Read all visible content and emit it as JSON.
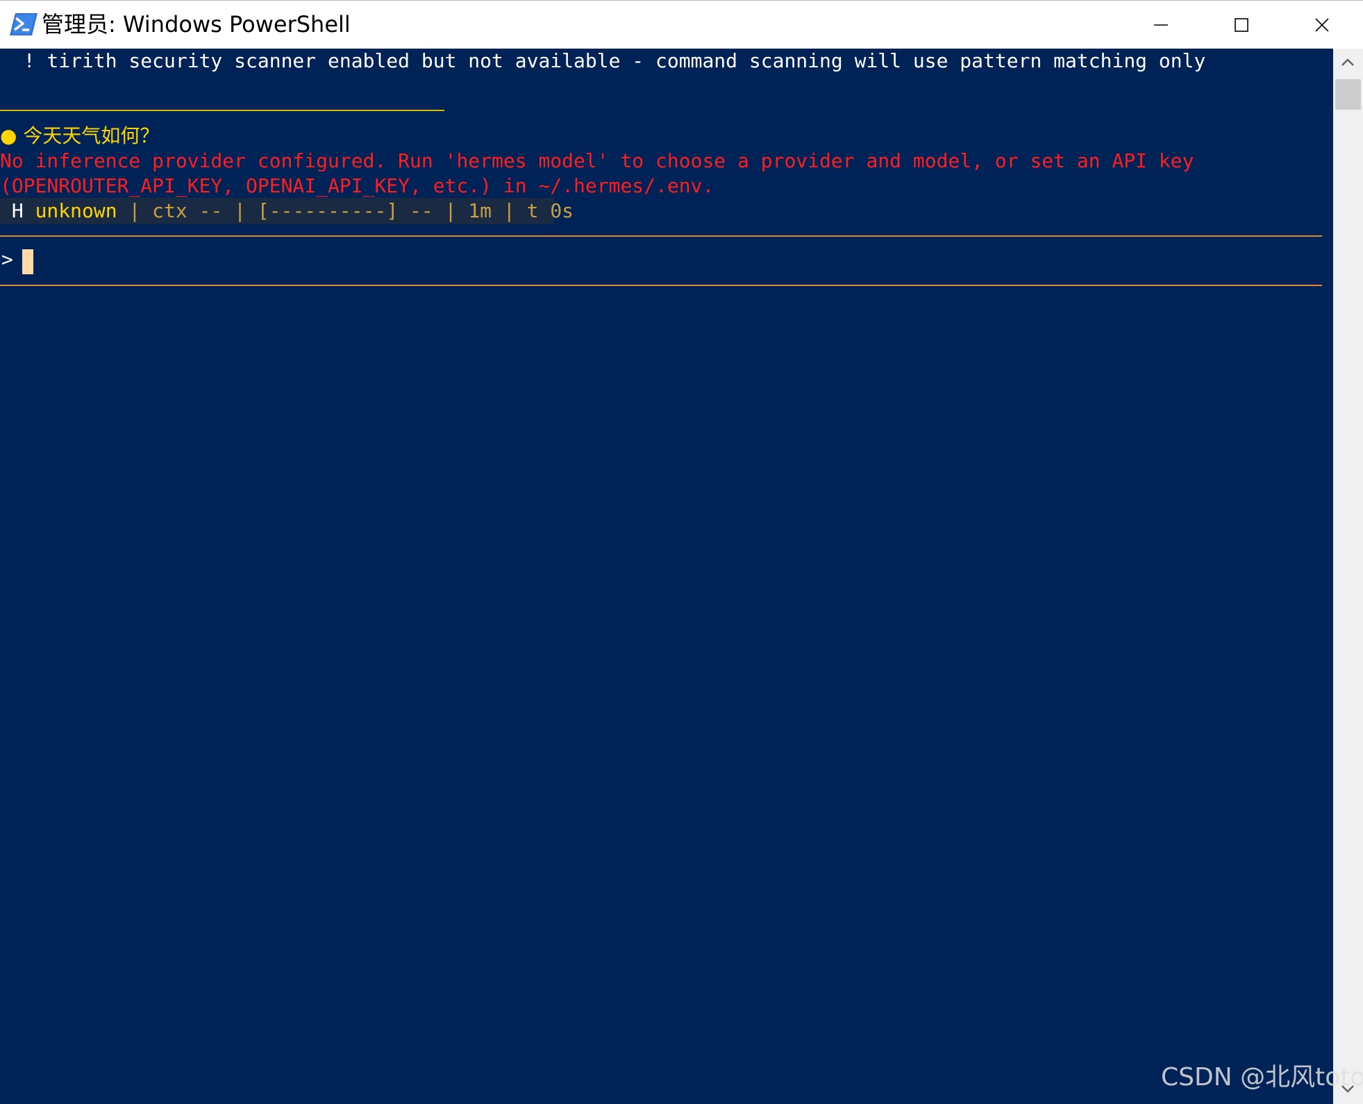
{
  "window": {
    "title": "管理员: Windows PowerShell",
    "icon": "powershell-icon",
    "controls": {
      "minimize_icon": "minimize-icon",
      "maximize_icon": "maximize-icon",
      "close_icon": "close-icon"
    }
  },
  "console": {
    "background": "#002357",
    "warning_line": "  ! tirith security scanner enabled but not available - command scanning will use pattern matching only",
    "question": {
      "bullet": "● ",
      "text": "今天天气如何？"
    },
    "error_lines": [
      "No inference provider configured. Run 'hermes model' to choose a provider and model, or set an API key",
      "(OPENROUTER_API_KEY, OPENAI_API_KEY, etc.) in ~/.hermes/.env."
    ],
    "status_bar": {
      "h": " H ",
      "model": "unknown",
      "rest": " | ctx -- | [----------] -- | 1m | t 0s "
    },
    "prompt": ">",
    "colors": {
      "text": "#ffffff",
      "question": "#ffd400",
      "error": "#ff1e1e",
      "rule": "#e08a30",
      "cursor": "#ffd9a8"
    }
  },
  "scrollbar": {
    "up_icon": "scroll-up-arrow-icon",
    "down_icon": "scroll-down-arrow-icon"
  },
  "watermark": "CSDN @北风toto"
}
